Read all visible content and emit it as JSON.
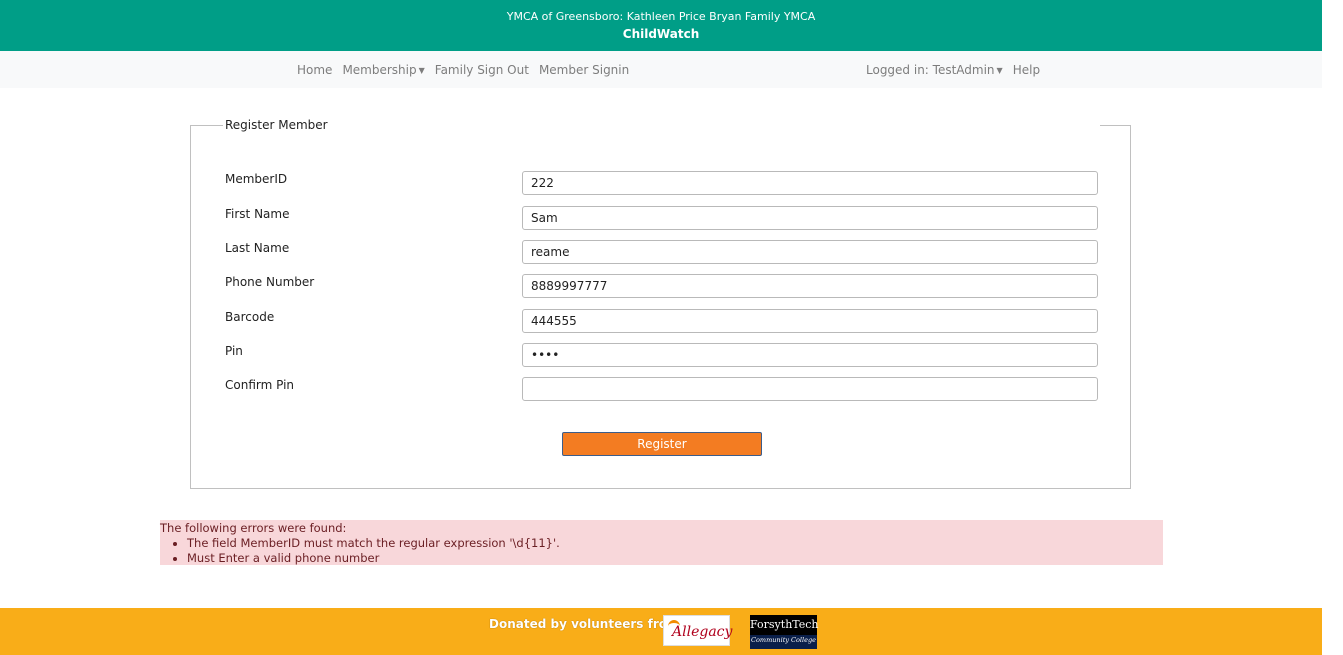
{
  "header": {
    "org_title": "YMCA of Greensboro: Kathleen Price Bryan Family YMCA",
    "app_title": "ChildWatch"
  },
  "nav": {
    "left": [
      {
        "label": "Home"
      },
      {
        "label": "Membership",
        "dropdown": true
      },
      {
        "label": "Family Sign Out"
      },
      {
        "label": "Member Signin"
      }
    ],
    "logged_in_label": "Logged in: TestAdmin",
    "help_label": "Help"
  },
  "form": {
    "legend": "Register Member",
    "fields": [
      {
        "label": "MemberID",
        "value": "222"
      },
      {
        "label": "First Name",
        "value": "Sam"
      },
      {
        "label": "Last Name",
        "value": "reame"
      },
      {
        "label": "Phone Number",
        "value": "8889997777"
      },
      {
        "label": "Barcode",
        "value": "444555"
      },
      {
        "label": "Pin",
        "value": "••••"
      },
      {
        "label": "Confirm Pin",
        "value": ""
      }
    ],
    "submit_label": "Register"
  },
  "errors": {
    "heading": "The following errors were found:",
    "items": [
      "The field MemberID must match the regular expression '\\d{11}'.",
      "Must Enter a valid phone number"
    ]
  },
  "footer": {
    "donated_text": "Donated by volunteers from:",
    "logos": {
      "allegacy": "Allegacy",
      "forsyth_top": "ForsythTech",
      "forsyth_bottom": "Community College"
    }
  },
  "colors": {
    "header_bg": "#009e87",
    "register_button": "#f37c22",
    "footer_bg": "#f9ad18",
    "error_bg": "#f8d7da"
  }
}
